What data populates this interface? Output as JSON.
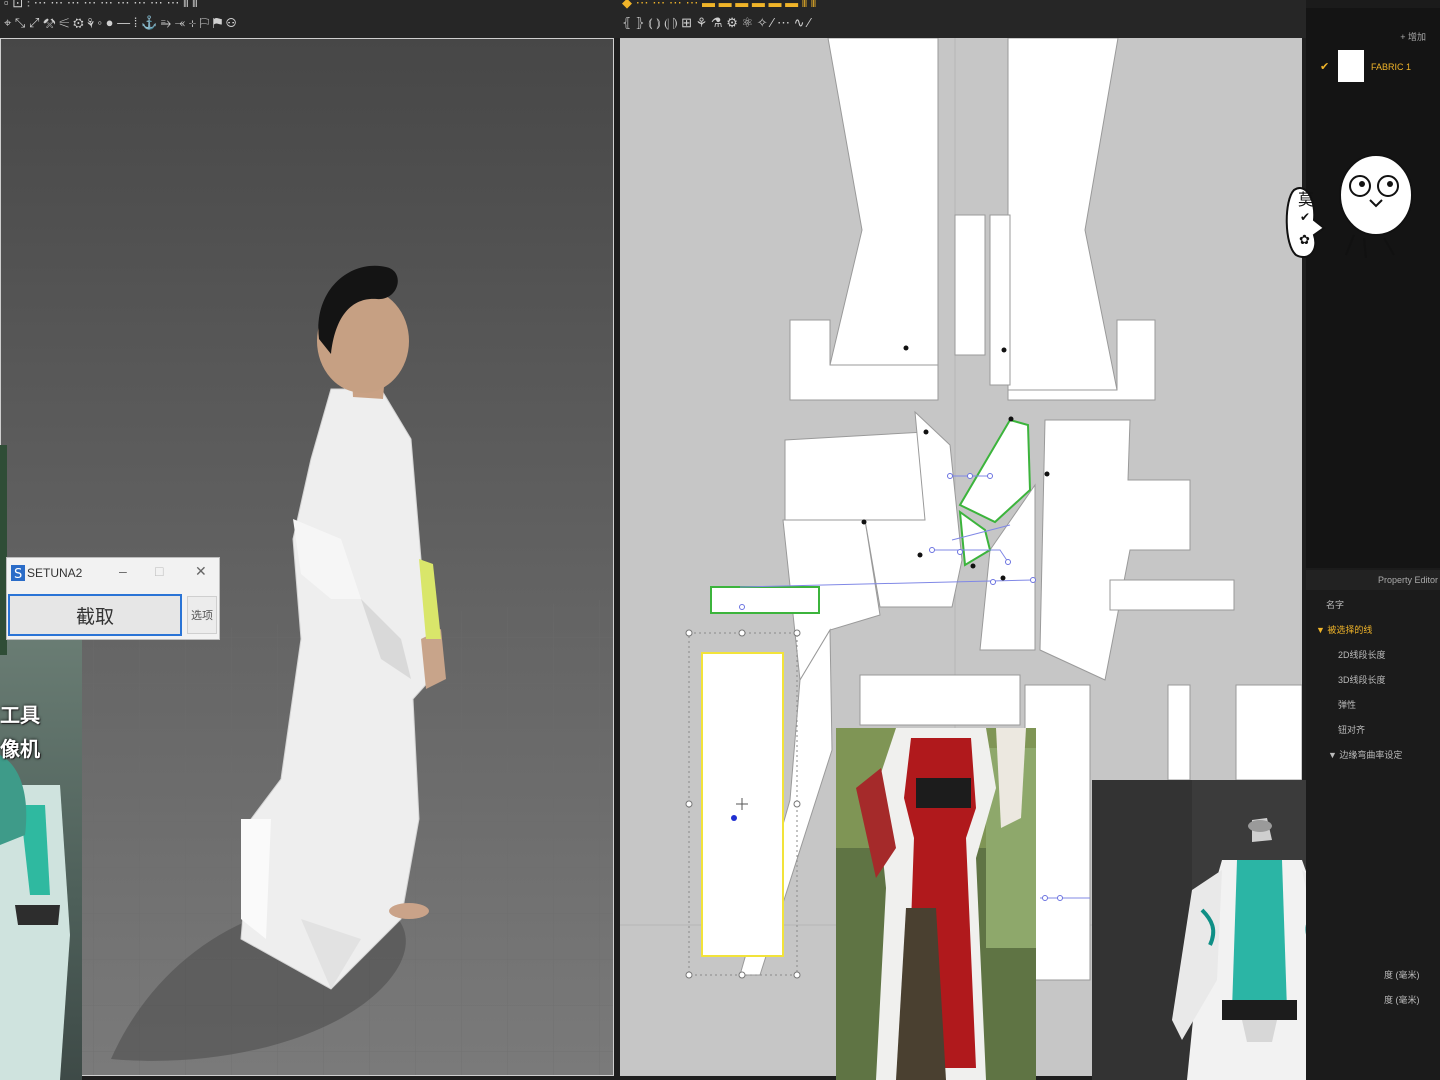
{
  "app": {
    "toolbar_left_row1": "▫ ⊡ ⫶ ⋯ ⋯ ⋯ ⋯ ⋯ ⋯ ⋯ ⋯ ⋯ ⫴ ⫴",
    "toolbar_left_row2": "⌖ ⤡ ⤢ ⚒ ⚟ ⚙ ⚘ ◦ ● — ⁞ ⚓ ⥱ ⤛ ⊹ ⚐ ⚑ ⚇",
    "toolbar_right_row1": "◆ ⋯ ⋯ ⋯ ⋯ ▬ ▬ ▬ ▬ ▬ ▬ ⫴ ⫴",
    "toolbar_right_row2": "⦃ ⦄ ⦅ ⦆ ⦇ ⦈ ⊞ ⚘ ⚗ ⚙ ⚛ ✧ ⁄ ⋯ ∿ ⁄"
  },
  "fabric_panel": {
    "fabric_name": "FABRIC 1",
    "add_label": "+ 增加"
  },
  "property_editor": {
    "title": "Property Editor",
    "items": [
      {
        "label": "名字",
        "highlight": false
      },
      {
        "label": "▼ 被选择的线",
        "highlight": true
      },
      {
        "label": "2D线段长度",
        "highlight": false
      },
      {
        "label": "3D线段长度",
        "highlight": false
      },
      {
        "label": "弹性",
        "highlight": false
      },
      {
        "label": "钮对齐",
        "highlight": false
      },
      {
        "label": "▼ 边缘弯曲率设定",
        "highlight": false
      }
    ],
    "unit_items": [
      "度 (毫米)",
      "度 (毫米)"
    ]
  },
  "setuna": {
    "title": "SETUNA2",
    "minimize": "–",
    "maximize": "□",
    "close": "✕",
    "capture_button": "截取",
    "options_button": "选项"
  },
  "overlay_text": {
    "line1": "工具",
    "line2": "像机"
  },
  "sticker": {
    "text_chars": [
      "莫",
      "✔",
      "✿"
    ]
  },
  "colors": {
    "accent": "#f0b429",
    "selection_green": "#3cb43c",
    "selection_yellow": "#f2e33a",
    "setuna_border": "#2a74d6"
  }
}
